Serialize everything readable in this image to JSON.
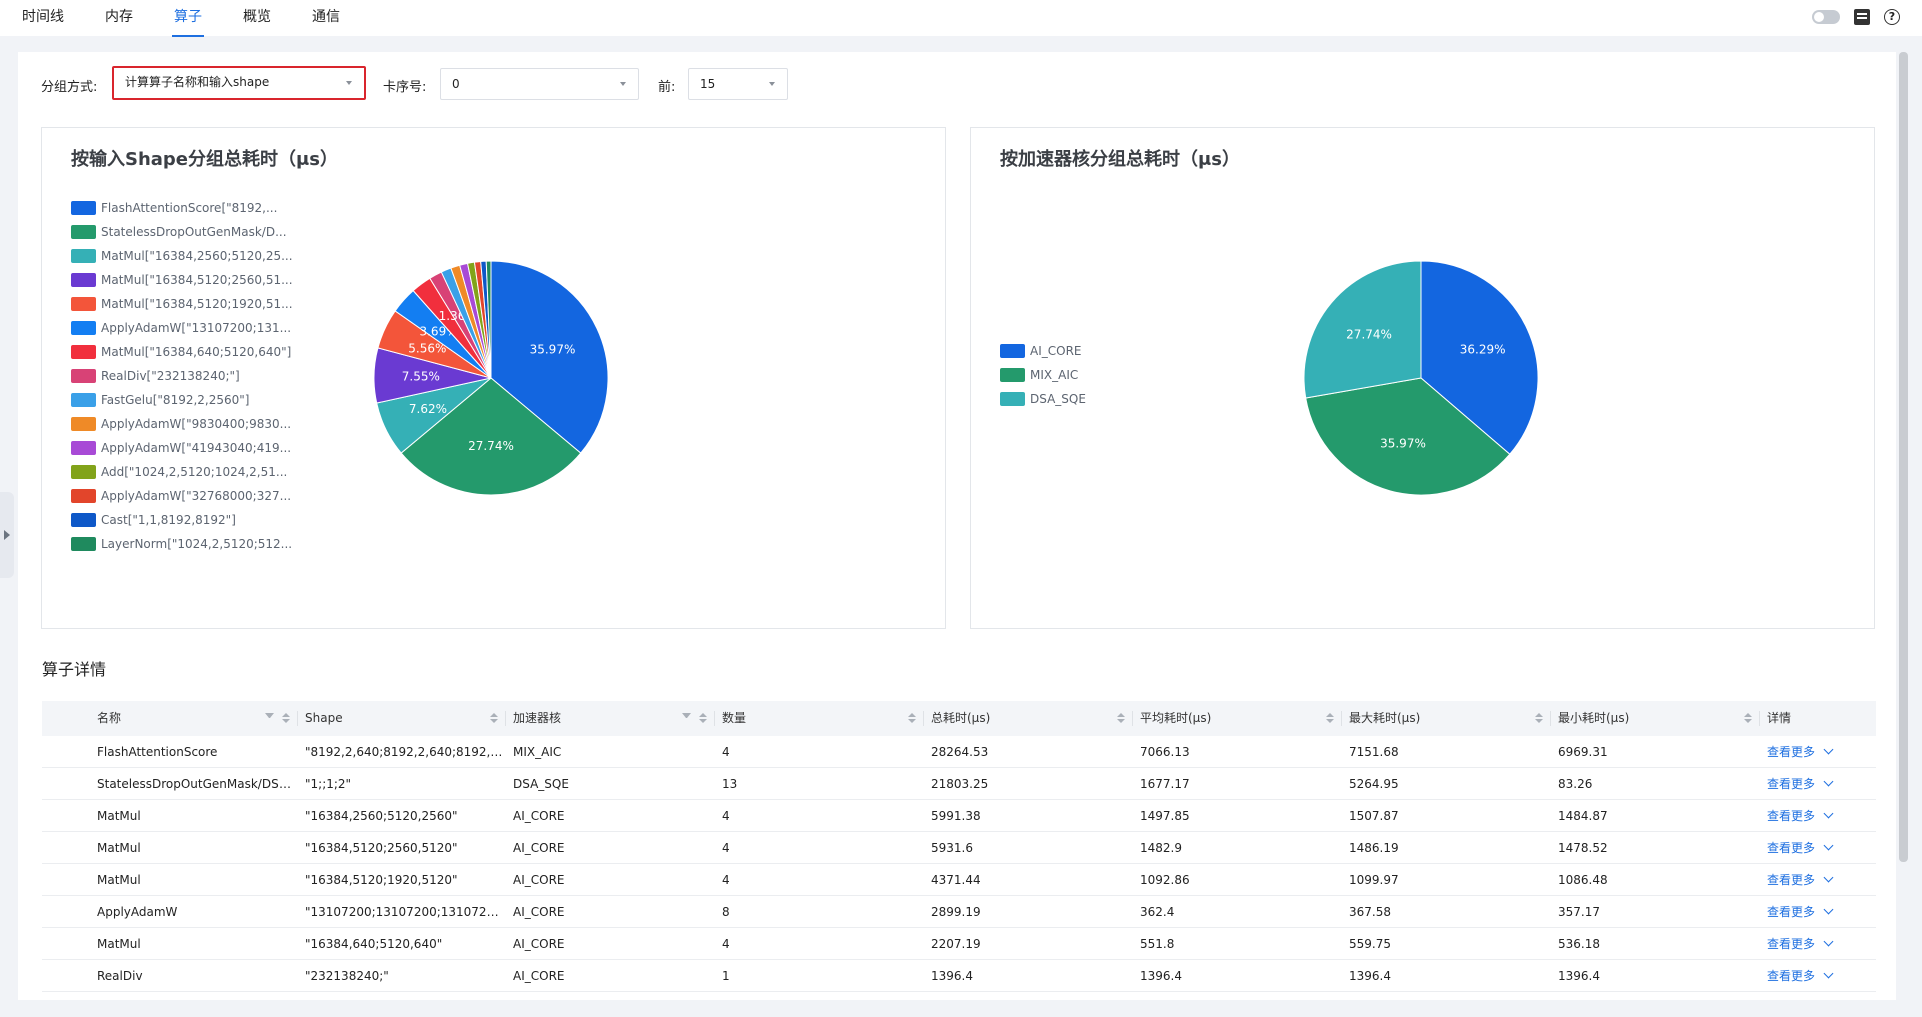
{
  "nav": {
    "tabs": [
      {
        "label": "时间线",
        "active": false
      },
      {
        "label": "内存",
        "active": false
      },
      {
        "label": "算子",
        "active": true
      },
      {
        "label": "概览",
        "active": false
      },
      {
        "label": "通信",
        "active": false
      }
    ]
  },
  "filters": {
    "group_label": "分组方式:",
    "group_value": "计算算子名称和输入shape",
    "card_label": "卡序号:",
    "card_value": "0",
    "top_label": "前:",
    "top_value": "15"
  },
  "colors": {
    "accent": "#1e6fe0",
    "highlight_border": "#d9252d"
  },
  "chart_data": [
    {
      "type": "pie",
      "title": "按输入Shape分组总耗时（μs）",
      "legend_position": "left",
      "categories": [
        "FlashAttentionScore[\"8192,...",
        "StatelessDropOutGenMask/D...",
        "MatMul[\"16384,2560;5120,25...",
        "MatMul[\"16384,5120;2560,51...",
        "MatMul[\"16384,5120;1920,51...",
        "ApplyAdamW[\"13107200;131...",
        "MatMul[\"16384,640;5120,640\"]",
        "RealDiv[\"232138240;\"]",
        "FastGelu[\"8192,2,2560\"]",
        "ApplyAdamW[\"9830400;9830...",
        "ApplyAdamW[\"41943040;419...",
        "Add[\"1024,2,5120;1024,2,51...",
        "ApplyAdamW[\"32768000;327...",
        "Cast[\"1,1,8192,8192\"]",
        "LayerNorm[\"1024,2,5120;512..."
      ],
      "values": [
        35.97,
        27.74,
        7.62,
        7.55,
        5.56,
        3.69,
        2.81,
        1.78,
        1.4,
        1.25,
        1.1,
        0.95,
        0.85,
        0.75,
        0.65
      ],
      "data_labels": [
        "35.97%",
        "27.74%",
        "7.62%",
        "7.55%",
        "5.56%",
        "3.69%",
        "",
        "1.36%",
        "",
        "",
        "",
        "",
        "",
        "",
        ""
      ],
      "colors": [
        "#1366e0",
        "#249a6c",
        "#35b0b6",
        "#6a3ad2",
        "#f3553a",
        "#137ef2",
        "#f12f3d",
        "#d84276",
        "#3aa0e8",
        "#ef8a27",
        "#a84ad6",
        "#82a31a",
        "#e2452b",
        "#0e58c8",
        "#1f8a5e"
      ]
    },
    {
      "type": "pie",
      "title": "按加速器核分组总耗时（μs）",
      "legend_position": "left",
      "categories": [
        "AI_CORE",
        "MIX_AIC",
        "DSA_SQE"
      ],
      "values": [
        36.29,
        35.97,
        27.74
      ],
      "data_labels": [
        "36.29%",
        "35.97%",
        "27.74%"
      ],
      "colors": [
        "#1366e0",
        "#249a6c",
        "#35b0b6"
      ]
    }
  ],
  "details": {
    "title": "算子详情",
    "columns": [
      "名称",
      "Shape",
      "加速器核",
      "数量",
      "总耗时(μs)",
      "平均耗时(μs)",
      "最大耗时(μs)",
      "最小耗时(μs)",
      "详情"
    ],
    "more_label": "查看更多",
    "rows": [
      [
        "FlashAttentionScore",
        "\"8192,2,640;8192,2,640;8192,2,6...",
        "MIX_AIC",
        "4",
        "28264.53",
        "7066.13",
        "7151.68",
        "6969.31"
      ],
      [
        "StatelessDropOutGenMask/DSA...",
        "\"1;;1;2\"",
        "DSA_SQE",
        "13",
        "21803.25",
        "1677.17",
        "5264.95",
        "83.26"
      ],
      [
        "MatMul",
        "\"16384,2560;5120,2560\"",
        "AI_CORE",
        "4",
        "5991.38",
        "1497.85",
        "1507.87",
        "1484.87"
      ],
      [
        "MatMul",
        "\"16384,5120;2560,5120\"",
        "AI_CORE",
        "4",
        "5931.6",
        "1482.9",
        "1486.19",
        "1478.52"
      ],
      [
        "MatMul",
        "\"16384,5120;1920,5120\"",
        "AI_CORE",
        "4",
        "4371.44",
        "1092.86",
        "1099.97",
        "1086.48"
      ],
      [
        "ApplyAdamW",
        "\"13107200;13107200;13107200;...",
        "AI_CORE",
        "8",
        "2899.19",
        "362.4",
        "367.58",
        "357.17"
      ],
      [
        "MatMul",
        "\"16384,640;5120,640\"",
        "AI_CORE",
        "4",
        "2207.19",
        "551.8",
        "559.75",
        "536.18"
      ],
      [
        "RealDiv",
        "\"232138240;\"",
        "AI_CORE",
        "1",
        "1396.4",
        "1396.4",
        "1396.4",
        "1396.4"
      ]
    ]
  }
}
